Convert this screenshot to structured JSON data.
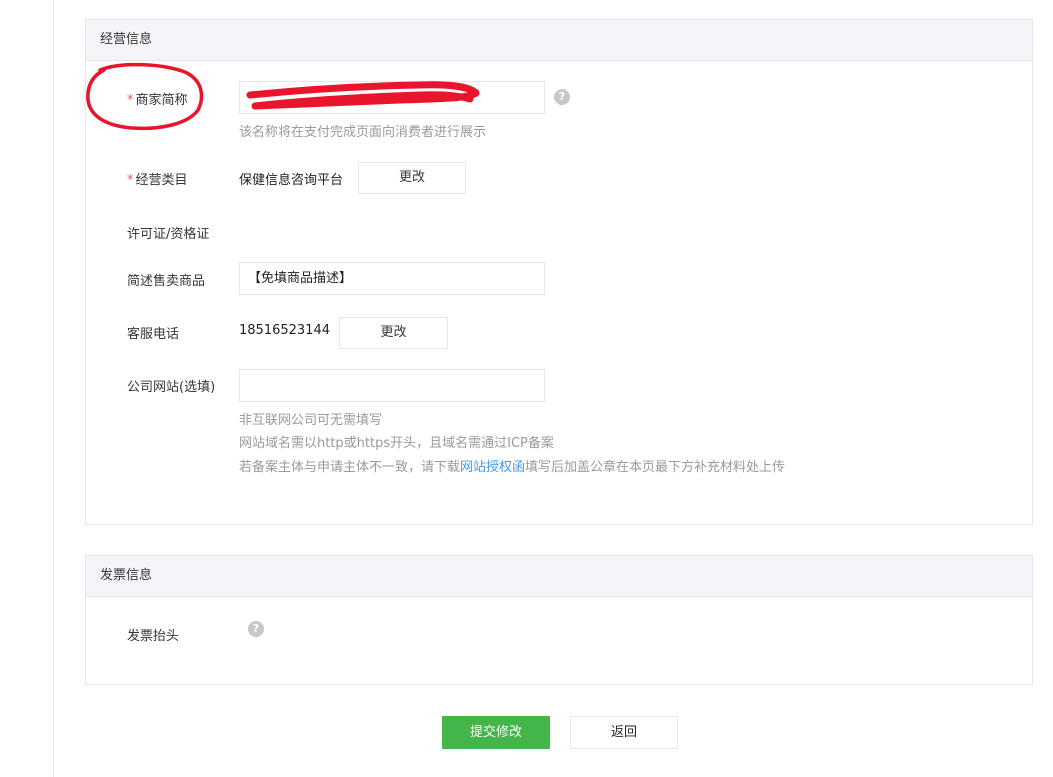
{
  "business": {
    "header": "经营信息",
    "merchant_name": {
      "required_mark": "*",
      "label": "商家简称",
      "help_icon": "question-mark-icon",
      "hint": "该名称将在支付完成页面向消费者进行展示"
    },
    "category": {
      "required_mark": "*",
      "label": "经营类目",
      "value": "保健信息咨询平台",
      "change_label": "更改"
    },
    "license": {
      "label": "许可证/资格证"
    },
    "goods_desc": {
      "label": "简述售卖商品",
      "value": "【免填商品描述】"
    },
    "service_phone": {
      "label": "客服电话",
      "value": "18516523144",
      "change_label": "更改"
    },
    "website": {
      "label": "公司网站(选填)",
      "value": "",
      "hint_1": "非互联网公司可无需填写",
      "hint_2": "网站域名需以http或https开头，且域名需通过ICP备案",
      "hint_3_before": "若备案主体与申请主体不一致，请下载",
      "hint_3_link": "网站授权函",
      "hint_3_after": "填写后加盖公章在本页最下方补充材料处上传"
    }
  },
  "invoice": {
    "header": "发票信息",
    "title_field": {
      "label": "发票抬头",
      "help_icon": "question-mark-icon"
    }
  },
  "actions": {
    "submit_label": "提交修改",
    "back_label": "返回"
  },
  "colors": {
    "primary_green": "#44b549",
    "required_red": "#e15f63",
    "link_blue": "#459ae9",
    "annotation_red": "#e8152c",
    "header_bg": "#f4f5f9",
    "border": "#e4e8eb"
  }
}
